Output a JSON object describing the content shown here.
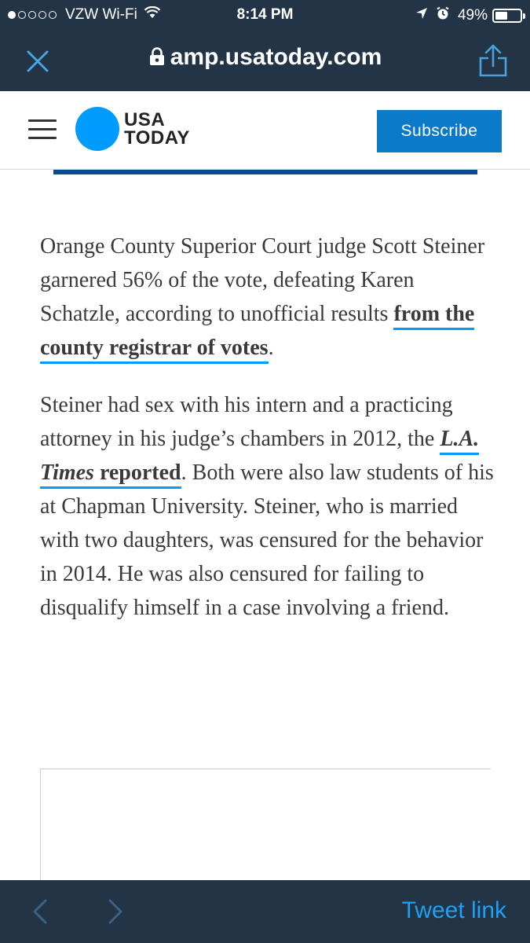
{
  "status_bar": {
    "carrier": "VZW Wi-Fi",
    "time": "8:14 PM",
    "battery": "49%",
    "battery_level": 0.49,
    "icons": [
      "signal-dots-icon",
      "wifi-icon",
      "location-arrow-icon",
      "alarm-clock-icon",
      "battery-icon"
    ]
  },
  "browser": {
    "url": "amp.usatoday.com",
    "icons": [
      "close-icon",
      "lock-icon",
      "share-icon"
    ]
  },
  "site_header": {
    "logo_line1": "USA",
    "logo_line2": "TODAY",
    "subscribe_label": "Subscribe",
    "icons": [
      "hamburger-menu-icon"
    ]
  },
  "article": {
    "p1_text": "Orange County Superior Court judge Scott Steiner garnered 56% of the vote, defeating Karen Schatzle, according to unofficial results ",
    "p1_link": "from the county registrar of votes",
    "p1_end": ".",
    "p2_text": "Steiner had sex with his intern and a practicing attorney in his judge’s chambers in 2012, the ",
    "p2_link_italic": "L.A. Times",
    "p2_link_rest": " reported",
    "p2_end": ". Both were also law students of his at Chapman University. Steiner, who is married with two daughters, was censured for the behavior in 2014. He was also censured for failing to disqualify himself in a case involving a friend."
  },
  "toolbar": {
    "tweet_label": "Tweet link",
    "icons": [
      "back-chevron-icon",
      "forward-chevron-icon"
    ]
  },
  "colors": {
    "chrome_bg": "#243447",
    "usa_today_blue": "#009bff",
    "subscribe_bg": "#0a7ac9",
    "rule_blue": "#0b4a8b",
    "tweet_blue": "#1da1f2"
  }
}
